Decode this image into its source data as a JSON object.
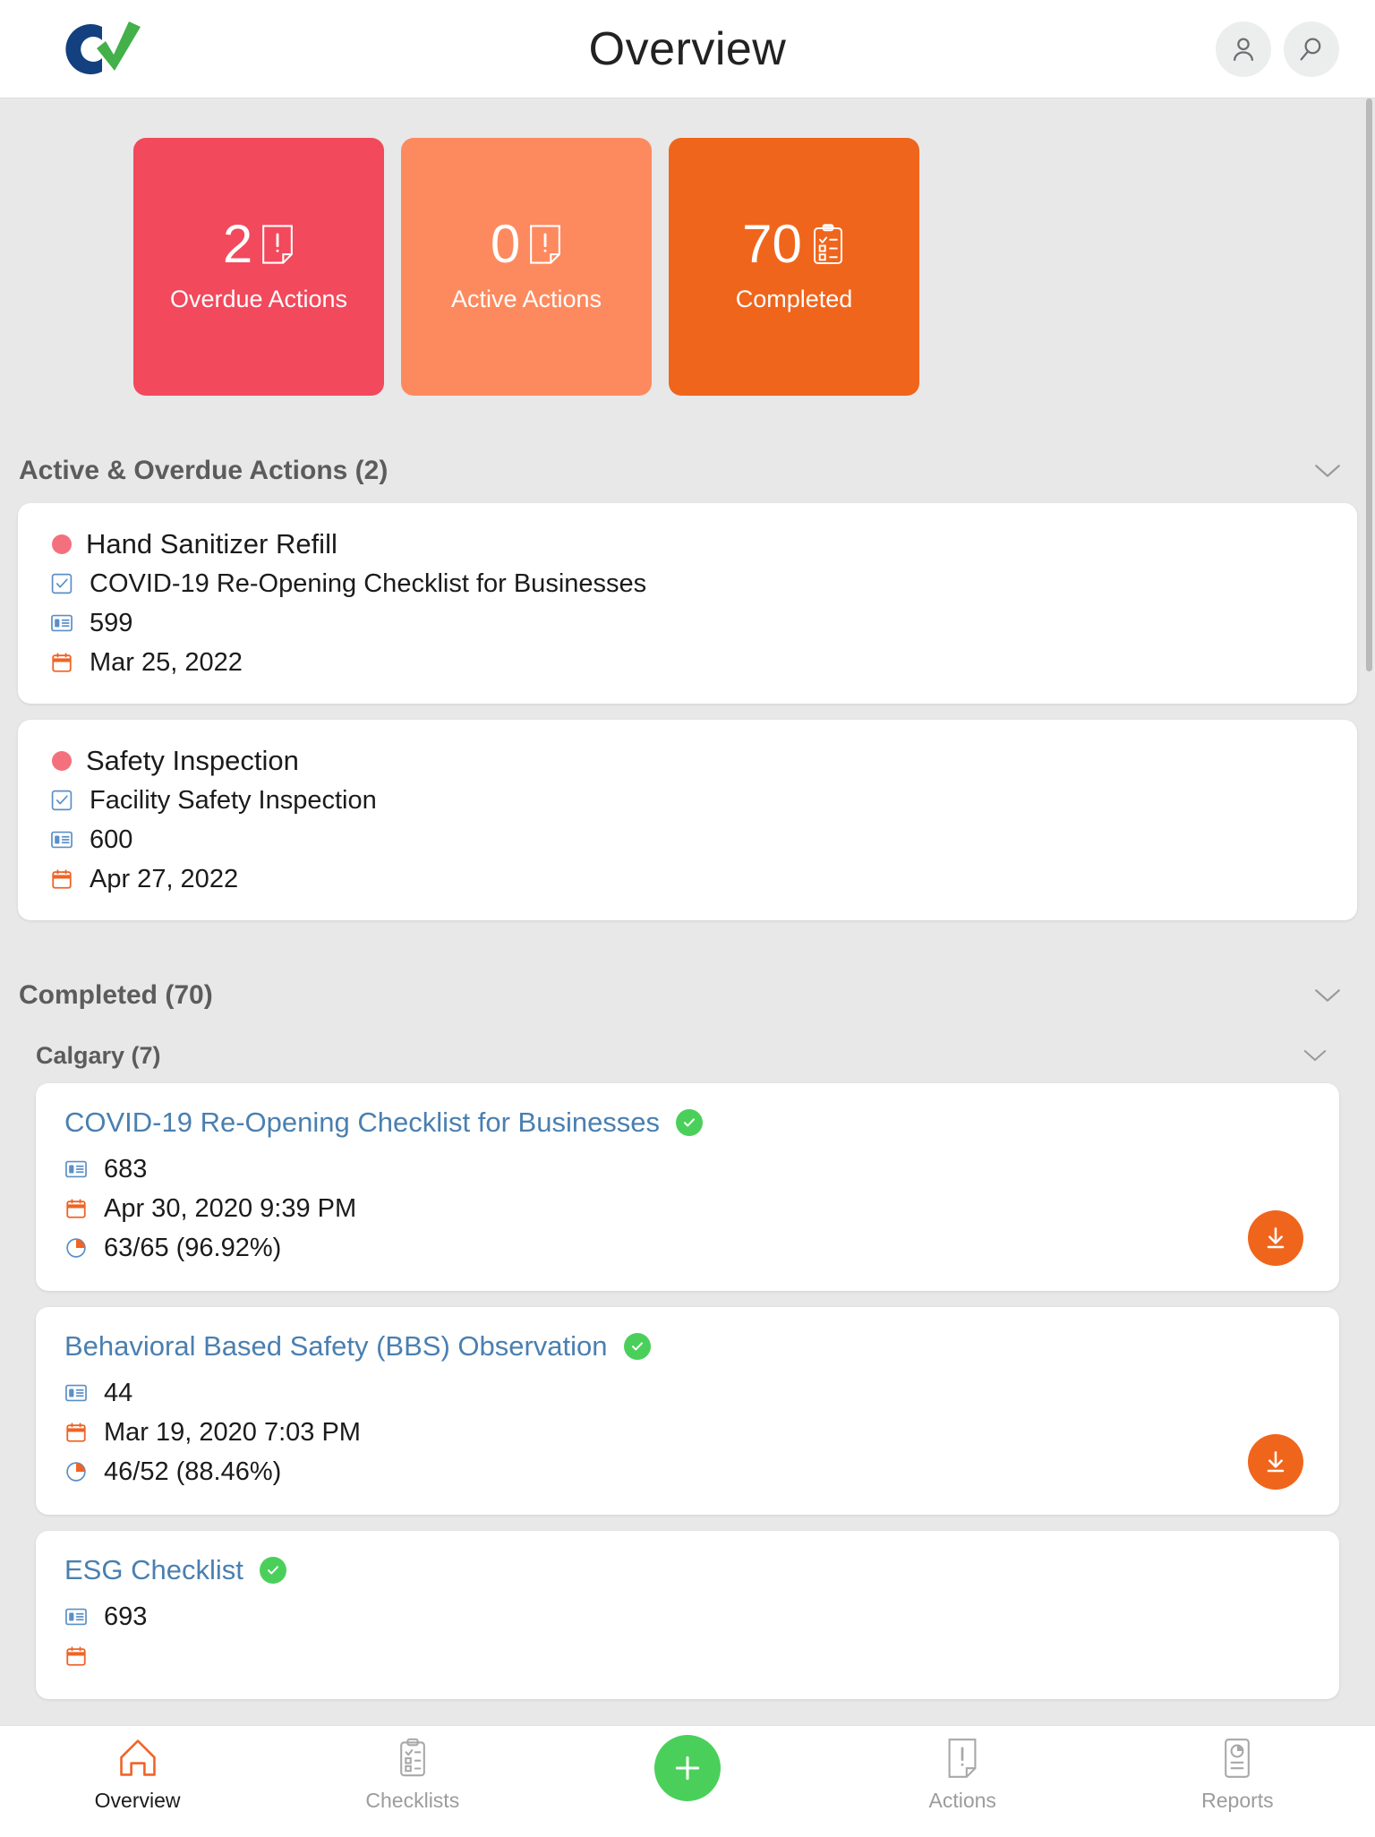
{
  "header": {
    "title": "Overview",
    "logo_alt": "company-logo",
    "profile_icon": "person-icon",
    "search_icon": "search-icon"
  },
  "stats": [
    {
      "value": "2",
      "label": "Overdue Actions",
      "color": "#f2495c",
      "icon": "document-alert-icon"
    },
    {
      "value": "0",
      "label": "Active Actions",
      "color": "#fd8a5e",
      "icon": "document-alert-icon"
    },
    {
      "value": "70",
      "label": "Completed",
      "color": "#f0651c",
      "icon": "clipboard-checklist-icon"
    }
  ],
  "active_section": {
    "title": "Active & Overdue Actions (2)",
    "chevron": "chevron-down-icon",
    "items": [
      {
        "status_dot": "#f4707d",
        "name": "Hand Sanitizer Refill",
        "checklist": "COVID-19 Re-Opening Checklist for Businesses",
        "id": "599",
        "date": "Mar 25, 2022"
      },
      {
        "status_dot": "#f4707d",
        "name": "Safety Inspection",
        "checklist": "Facility Safety Inspection",
        "id": "600",
        "date": "Apr 27, 2022"
      }
    ]
  },
  "completed_section": {
    "title": "Completed (70)",
    "chevron": "chevron-down-icon",
    "group": {
      "title": "Calgary (7)",
      "chevron": "chevron-down-icon",
      "items": [
        {
          "title": "COVID-19 Re-Opening Checklist for Businesses",
          "verified_icon": "green-check-icon",
          "id": "683",
          "date": "Apr 30, 2020 9:39 PM",
          "score": "63/65 (96.92%)",
          "download_icon": "download-icon"
        },
        {
          "title": "Behavioral Based Safety (BBS) Observation",
          "verified_icon": "green-check-icon",
          "id": "44",
          "date": "Mar 19, 2020 7:03 PM",
          "score": "46/52 (88.46%)",
          "download_icon": "download-icon"
        },
        {
          "title": "ESG Checklist",
          "verified_icon": "green-check-icon",
          "id": "693",
          "date": "",
          "score": "",
          "download_icon": "download-icon"
        }
      ]
    }
  },
  "bottom_nav": {
    "items": [
      {
        "label": "Overview",
        "icon": "home-icon",
        "active": true
      },
      {
        "label": "Checklists",
        "icon": "clipboard-icon",
        "active": false
      },
      {
        "label": "Actions",
        "icon": "document-alert-icon",
        "active": false
      },
      {
        "label": "Reports",
        "icon": "report-chart-icon",
        "active": false
      }
    ],
    "fab": {
      "icon": "plus-icon",
      "color": "#4ad05a"
    }
  },
  "colors": {
    "overdue": "#f2495c",
    "active": "#fd8a5e",
    "completed": "#f0651c",
    "accent_orange": "#f0651c",
    "link_blue": "#4a7fb0",
    "green": "#4ad05a",
    "page_bg": "#e8e8e8"
  }
}
